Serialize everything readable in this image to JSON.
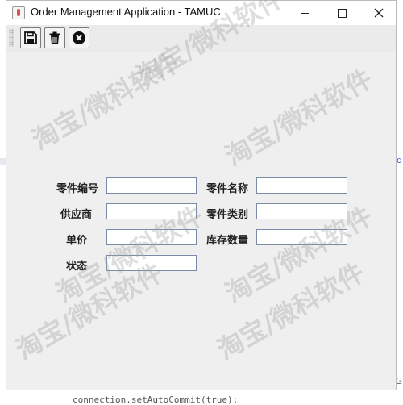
{
  "window": {
    "title": "Order Management Application - TAMUC"
  },
  "toolbar": {
    "buttons": [
      {
        "name": "save",
        "icon": "floppy-disk-icon"
      },
      {
        "name": "delete",
        "icon": "trash-icon"
      },
      {
        "name": "cancel",
        "icon": "close-circle-icon"
      }
    ]
  },
  "form": {
    "part_number_label": "零件编号",
    "part_name_label": "零件名称",
    "supplier_label": "供应商",
    "part_category_label": "零件类别",
    "unit_price_label": "单价",
    "stock_quantity_label": "库存数量",
    "status_label": "状态",
    "part_number_value": "",
    "part_name_value": "",
    "supplier_value": "",
    "part_category_value": "",
    "unit_price_value": "",
    "stock_quantity_value": "",
    "status_value": ""
  },
  "watermark": {
    "text": "淘宝/微科软件"
  },
  "background": {
    "code_line": "connection.setAutoCommit(true);",
    "edge_char_right": "d",
    "edge_char_bottom": "G"
  },
  "colors": {
    "window_bg": "#efefef",
    "titlebar_bg": "#ffffff",
    "field_border": "#7a8ba8"
  }
}
